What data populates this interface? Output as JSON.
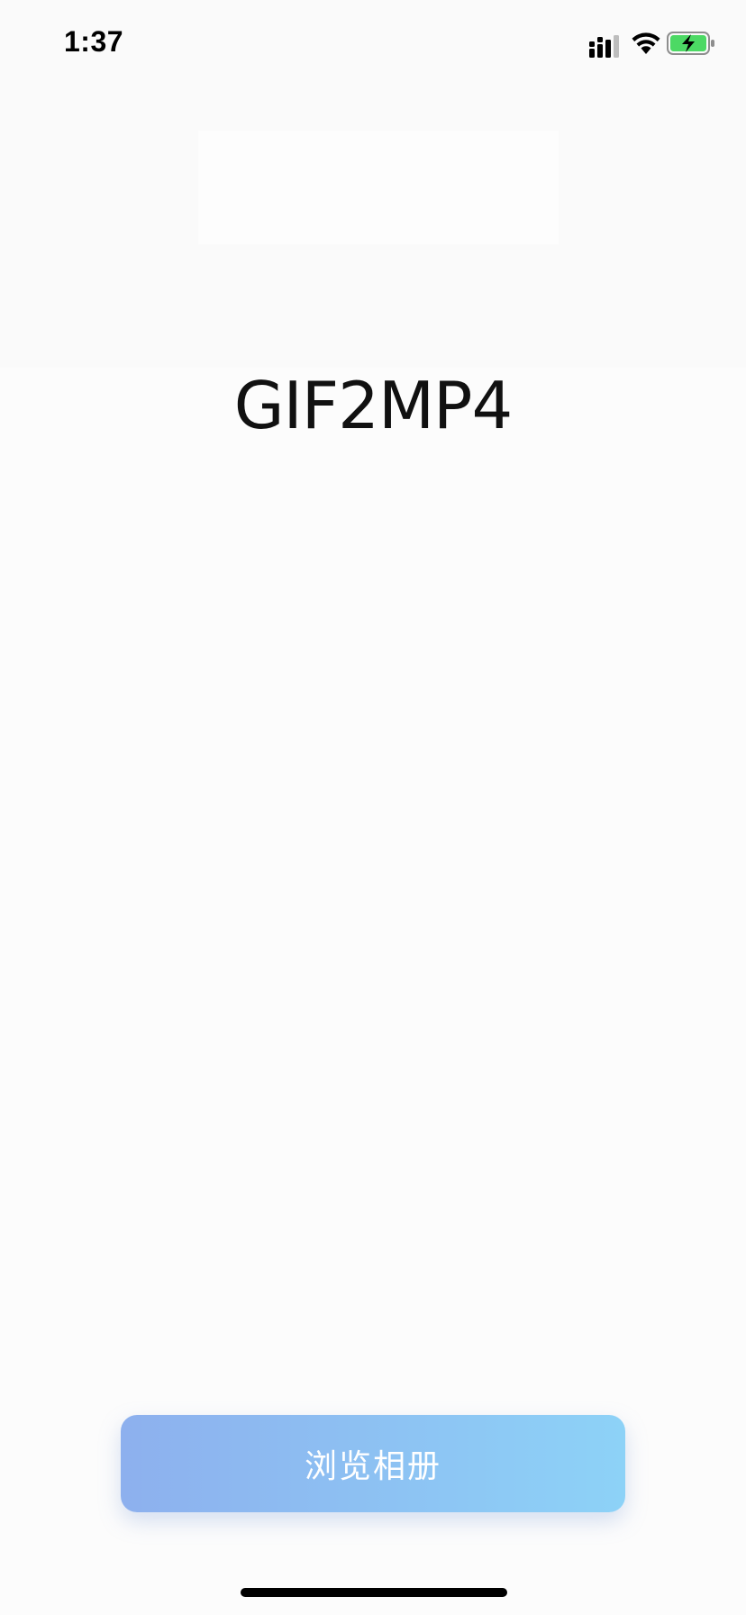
{
  "status_bar": {
    "time": "1:37",
    "icons": [
      "cellular-signal-icon",
      "wifi-icon",
      "battery-charging-icon"
    ],
    "battery_color": "#4cd964"
  },
  "main": {
    "title": "GIF2MP4"
  },
  "actions": {
    "browse_album_label": "浏览相册"
  },
  "colors": {
    "button_gradient_start": "#8db0ee",
    "button_gradient_end": "#8dd2f7",
    "background": "#fcfcfc"
  }
}
